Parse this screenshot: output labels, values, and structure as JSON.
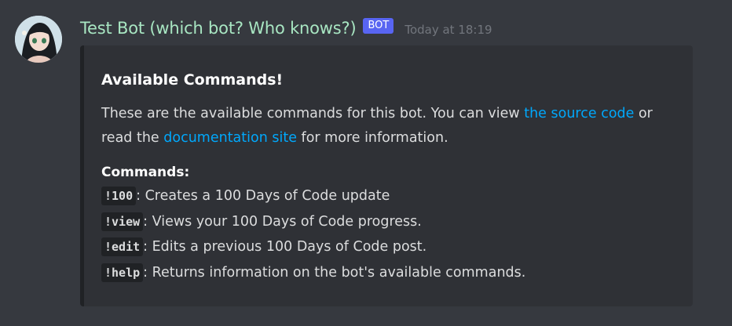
{
  "message": {
    "username": "Test Bot (which bot? Who knows?)",
    "bot_tag": "BOT",
    "timestamp": "Today at 18:19"
  },
  "embed": {
    "title": "Available Commands!",
    "description": {
      "part1": "These are the available commands for this bot. You can view ",
      "link1": "the source code",
      "part2": " or read the ",
      "link2": "documentation site",
      "part3": " for more information."
    },
    "field_name": "Commands:",
    "commands": [
      {
        "cmd": "!100",
        "desc": ": Creates a 100 Days of Code update"
      },
      {
        "cmd": "!view",
        "desc": ": Views your 100 Days of Code progress."
      },
      {
        "cmd": "!edit",
        "desc": ": Edits a previous 100 Days of Code post."
      },
      {
        "cmd": "!help",
        "desc": ": Returns information on the bot's available commands."
      }
    ]
  },
  "colors": {
    "background": "#36393f",
    "embed_bg": "#2f3136",
    "username": "#a8e6c2",
    "bot_tag": "#5865f2",
    "link": "#00a8fc"
  }
}
